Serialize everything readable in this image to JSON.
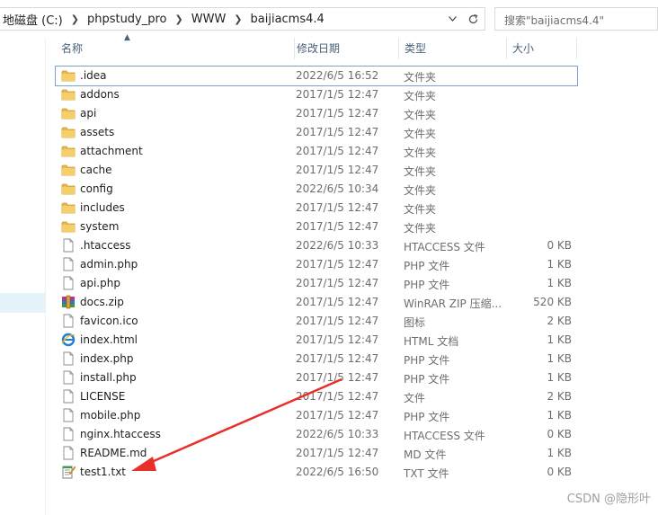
{
  "breadcrumb": [
    "地磁盘 (C:)",
    "phpstudy_pro",
    "WWW",
    "baijiacms4.4"
  ],
  "search": {
    "placeholder": "搜索\"baijiacms4.4\""
  },
  "columns": {
    "name": "名称",
    "date": "修改日期",
    "type": "类型",
    "size": "大小"
  },
  "files": [
    {
      "name": ".idea",
      "date": "2022/6/5 16:52",
      "type": "文件夹",
      "size": "",
      "icon": "folder-icon"
    },
    {
      "name": "addons",
      "date": "2017/1/5 12:47",
      "type": "文件夹",
      "size": "",
      "icon": "folder-icon"
    },
    {
      "name": "api",
      "date": "2017/1/5 12:47",
      "type": "文件夹",
      "size": "",
      "icon": "folder-icon"
    },
    {
      "name": "assets",
      "date": "2017/1/5 12:47",
      "type": "文件夹",
      "size": "",
      "icon": "folder-icon"
    },
    {
      "name": "attachment",
      "date": "2017/1/5 12:47",
      "type": "文件夹",
      "size": "",
      "icon": "folder-icon"
    },
    {
      "name": "cache",
      "date": "2017/1/5 12:47",
      "type": "文件夹",
      "size": "",
      "icon": "folder-icon"
    },
    {
      "name": "config",
      "date": "2022/6/5 10:34",
      "type": "文件夹",
      "size": "",
      "icon": "folder-icon"
    },
    {
      "name": "includes",
      "date": "2017/1/5 12:47",
      "type": "文件夹",
      "size": "",
      "icon": "folder-icon"
    },
    {
      "name": "system",
      "date": "2017/1/5 12:47",
      "type": "文件夹",
      "size": "",
      "icon": "folder-icon"
    },
    {
      "name": ".htaccess",
      "date": "2022/6/5 10:33",
      "type": "HTACCESS 文件",
      "size": "0 KB",
      "icon": "file-icon"
    },
    {
      "name": "admin.php",
      "date": "2017/1/5 12:47",
      "type": "PHP 文件",
      "size": "1 KB",
      "icon": "file-icon"
    },
    {
      "name": "api.php",
      "date": "2017/1/5 12:47",
      "type": "PHP 文件",
      "size": "1 KB",
      "icon": "file-icon"
    },
    {
      "name": "docs.zip",
      "date": "2017/1/5 12:47",
      "type": "WinRAR ZIP 压缩...",
      "size": "520 KB",
      "icon": "zip-icon"
    },
    {
      "name": "favicon.ico",
      "date": "2017/1/5 12:47",
      "type": "图标",
      "size": "2 KB",
      "icon": "file-icon"
    },
    {
      "name": "index.html",
      "date": "2017/1/5 12:47",
      "type": "HTML 文档",
      "size": "1 KB",
      "icon": "ie-icon"
    },
    {
      "name": "index.php",
      "date": "2017/1/5 12:47",
      "type": "PHP 文件",
      "size": "1 KB",
      "icon": "file-icon"
    },
    {
      "name": "install.php",
      "date": "2017/1/5 12:47",
      "type": "PHP 文件",
      "size": "1 KB",
      "icon": "file-icon"
    },
    {
      "name": "LICENSE",
      "date": "2017/1/5 12:47",
      "type": "文件",
      "size": "2 KB",
      "icon": "file-icon"
    },
    {
      "name": "mobile.php",
      "date": "2017/1/5 12:47",
      "type": "PHP 文件",
      "size": "1 KB",
      "icon": "file-icon"
    },
    {
      "name": "nginx.htaccess",
      "date": "2022/6/5 10:33",
      "type": "HTACCESS 文件",
      "size": "0 KB",
      "icon": "file-icon"
    },
    {
      "name": "README.md",
      "date": "2017/1/5 12:47",
      "type": "MD 文件",
      "size": "1 KB",
      "icon": "file-icon"
    },
    {
      "name": "test1.txt",
      "date": "2022/6/5 16:50",
      "type": "TXT 文件",
      "size": "0 KB",
      "icon": "txt-icon"
    }
  ],
  "selected_index": 0,
  "watermark": "CSDN @隐形叶",
  "colors": {
    "annotation_arrow": "#e8302a",
    "selection_border": "#7da2ce",
    "folder": "#e8b84a"
  }
}
